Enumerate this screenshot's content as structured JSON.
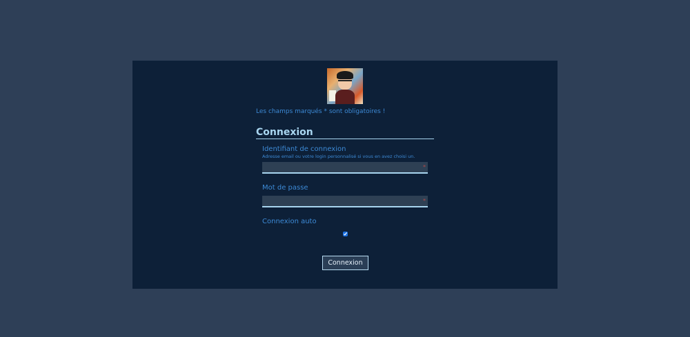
{
  "form": {
    "required_note": "Les champs marqués * sont obligatoires !",
    "title": "Connexion",
    "login": {
      "label": "Identifiant de connexion",
      "help": "Adresse email ou votre login personnalisé si vous en avez choisi un.",
      "value": "",
      "required_mark": "*"
    },
    "password": {
      "label": "Mot de passe",
      "value": "",
      "required_mark": "*"
    },
    "auto_login": {
      "label": "Connexion auto",
      "checked": true
    },
    "submit_label": "Connexion"
  },
  "colors": {
    "page_background": "#2e3f57",
    "panel_background": "#0d2038",
    "label_blue": "#3d8ad6",
    "title_light_blue": "#a9d6f0"
  }
}
